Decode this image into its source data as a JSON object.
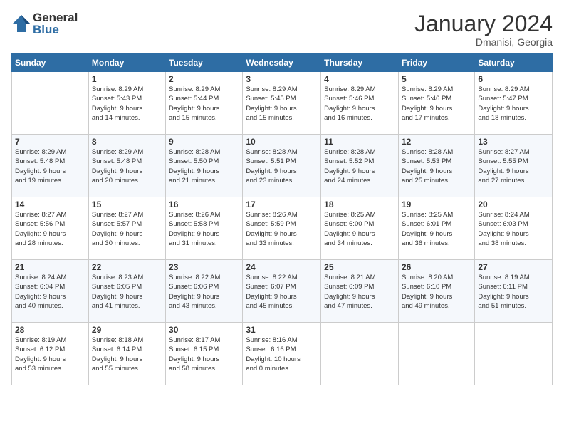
{
  "logo": {
    "general": "General",
    "blue": "Blue"
  },
  "header": {
    "title": "January 2024",
    "subtitle": "Dmanisi, Georgia"
  },
  "weekdays": [
    "Sunday",
    "Monday",
    "Tuesday",
    "Wednesday",
    "Thursday",
    "Friday",
    "Saturday"
  ],
  "weeks": [
    [
      {
        "day": "",
        "info": ""
      },
      {
        "day": "1",
        "info": "Sunrise: 8:29 AM\nSunset: 5:43 PM\nDaylight: 9 hours\nand 14 minutes."
      },
      {
        "day": "2",
        "info": "Sunrise: 8:29 AM\nSunset: 5:44 PM\nDaylight: 9 hours\nand 15 minutes."
      },
      {
        "day": "3",
        "info": "Sunrise: 8:29 AM\nSunset: 5:45 PM\nDaylight: 9 hours\nand 15 minutes."
      },
      {
        "day": "4",
        "info": "Sunrise: 8:29 AM\nSunset: 5:46 PM\nDaylight: 9 hours\nand 16 minutes."
      },
      {
        "day": "5",
        "info": "Sunrise: 8:29 AM\nSunset: 5:46 PM\nDaylight: 9 hours\nand 17 minutes."
      },
      {
        "day": "6",
        "info": "Sunrise: 8:29 AM\nSunset: 5:47 PM\nDaylight: 9 hours\nand 18 minutes."
      }
    ],
    [
      {
        "day": "7",
        "info": ""
      },
      {
        "day": "8",
        "info": "Sunrise: 8:29 AM\nSunset: 5:48 PM\nDaylight: 9 hours\nand 20 minutes."
      },
      {
        "day": "9",
        "info": "Sunrise: 8:28 AM\nSunset: 5:50 PM\nDaylight: 9 hours\nand 21 minutes."
      },
      {
        "day": "10",
        "info": "Sunrise: 8:28 AM\nSunset: 5:51 PM\nDaylight: 9 hours\nand 23 minutes."
      },
      {
        "day": "11",
        "info": "Sunrise: 8:28 AM\nSunset: 5:52 PM\nDaylight: 9 hours\nand 24 minutes."
      },
      {
        "day": "12",
        "info": "Sunrise: 8:28 AM\nSunset: 5:53 PM\nDaylight: 9 hours\nand 25 minutes."
      },
      {
        "day": "13",
        "info": "Sunrise: 8:27 AM\nSunset: 5:55 PM\nDaylight: 9 hours\nand 27 minutes."
      }
    ],
    [
      {
        "day": "14",
        "info": ""
      },
      {
        "day": "15",
        "info": "Sunrise: 8:27 AM\nSunset: 5:57 PM\nDaylight: 9 hours\nand 30 minutes."
      },
      {
        "day": "16",
        "info": "Sunrise: 8:26 AM\nSunset: 5:58 PM\nDaylight: 9 hours\nand 31 minutes."
      },
      {
        "day": "17",
        "info": "Sunrise: 8:26 AM\nSunset: 5:59 PM\nDaylight: 9 hours\nand 33 minutes."
      },
      {
        "day": "18",
        "info": "Sunrise: 8:25 AM\nSunset: 6:00 PM\nDaylight: 9 hours\nand 34 minutes."
      },
      {
        "day": "19",
        "info": "Sunrise: 8:25 AM\nSunset: 6:01 PM\nDaylight: 9 hours\nand 36 minutes."
      },
      {
        "day": "20",
        "info": "Sunrise: 8:24 AM\nSunset: 6:03 PM\nDaylight: 9 hours\nand 38 minutes."
      }
    ],
    [
      {
        "day": "21",
        "info": ""
      },
      {
        "day": "22",
        "info": "Sunrise: 8:23 AM\nSunset: 6:05 PM\nDaylight: 9 hours\nand 41 minutes."
      },
      {
        "day": "23",
        "info": "Sunrise: 8:22 AM\nSunset: 6:06 PM\nDaylight: 9 hours\nand 43 minutes."
      },
      {
        "day": "24",
        "info": "Sunrise: 8:22 AM\nSunset: 6:07 PM\nDaylight: 9 hours\nand 45 minutes."
      },
      {
        "day": "25",
        "info": "Sunrise: 8:21 AM\nSunset: 6:09 PM\nDaylight: 9 hours\nand 47 minutes."
      },
      {
        "day": "26",
        "info": "Sunrise: 8:20 AM\nSunset: 6:10 PM\nDaylight: 9 hours\nand 49 minutes."
      },
      {
        "day": "27",
        "info": "Sunrise: 8:19 AM\nSunset: 6:11 PM\nDaylight: 9 hours\nand 51 minutes."
      }
    ],
    [
      {
        "day": "28",
        "info": ""
      },
      {
        "day": "29",
        "info": "Sunrise: 8:18 AM\nSunset: 6:14 PM\nDaylight: 9 hours\nand 55 minutes."
      },
      {
        "day": "30",
        "info": "Sunrise: 8:17 AM\nSunset: 6:15 PM\nDaylight: 9 hours\nand 58 minutes."
      },
      {
        "day": "31",
        "info": "Sunrise: 8:16 AM\nSunset: 6:16 PM\nDaylight: 10 hours\nand 0 minutes."
      },
      {
        "day": "",
        "info": ""
      },
      {
        "day": "",
        "info": ""
      },
      {
        "day": "",
        "info": ""
      }
    ]
  ],
  "week1_sun_info": "Sunrise: 8:29 AM\nSunset: 5:48 PM\nDaylight: 9 hours\nand 19 minutes.",
  "week2_sun_info": "Sunrise: 8:27 AM\nSunset: 5:56 PM\nDaylight: 9 hours\nand 28 minutes.",
  "week3_sun_info": "Sunrise: 8:24 AM\nSunset: 6:04 PM\nDaylight: 9 hours\nand 40 minutes.",
  "week4_sun_info": "Sunrise: 8:19 AM\nSunset: 6:12 PM\nDaylight: 9 hours\nand 53 minutes."
}
